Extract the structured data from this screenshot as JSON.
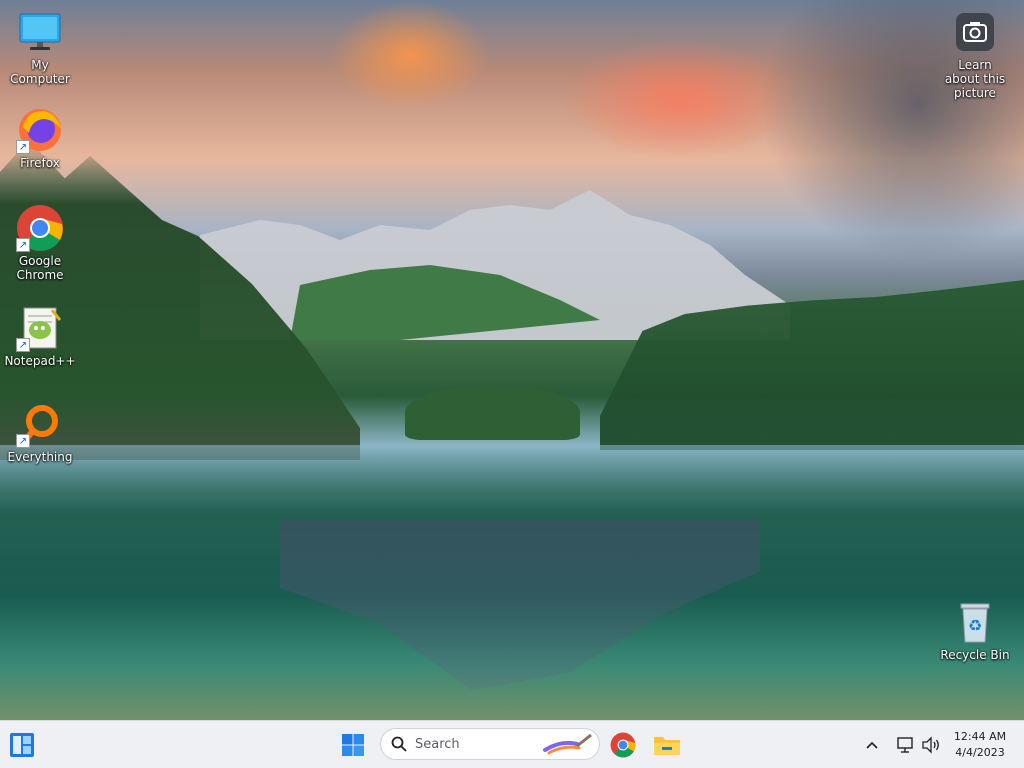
{
  "desktop": {
    "icons": [
      {
        "label": "My Computer",
        "icon": "monitor-icon"
      },
      {
        "label": "Firefox",
        "icon": "firefox-icon"
      },
      {
        "label": "Google Chrome",
        "icon": "chrome-icon"
      },
      {
        "label": "Notepad++",
        "icon": "notepad-plus-plus-icon"
      },
      {
        "label": "Everything",
        "icon": "everything-search-icon"
      }
    ],
    "spotlight": {
      "label": "Learn about this picture",
      "icon": "camera-icon"
    },
    "recycle_bin": {
      "label": "Recycle Bin",
      "icon": "recycle-bin-icon"
    }
  },
  "taskbar": {
    "search_placeholder": "Search",
    "clock_time": "12:44 AM",
    "clock_date": "4/4/2023",
    "apps": [
      "chrome-icon",
      "file-explorer-icon"
    ],
    "tray_icons": [
      "chevron-up-icon",
      "network-icon",
      "volume-icon"
    ]
  },
  "colors": {
    "taskbar_bg": "#eef0f4",
    "win_blue": "#1f7ae0"
  }
}
